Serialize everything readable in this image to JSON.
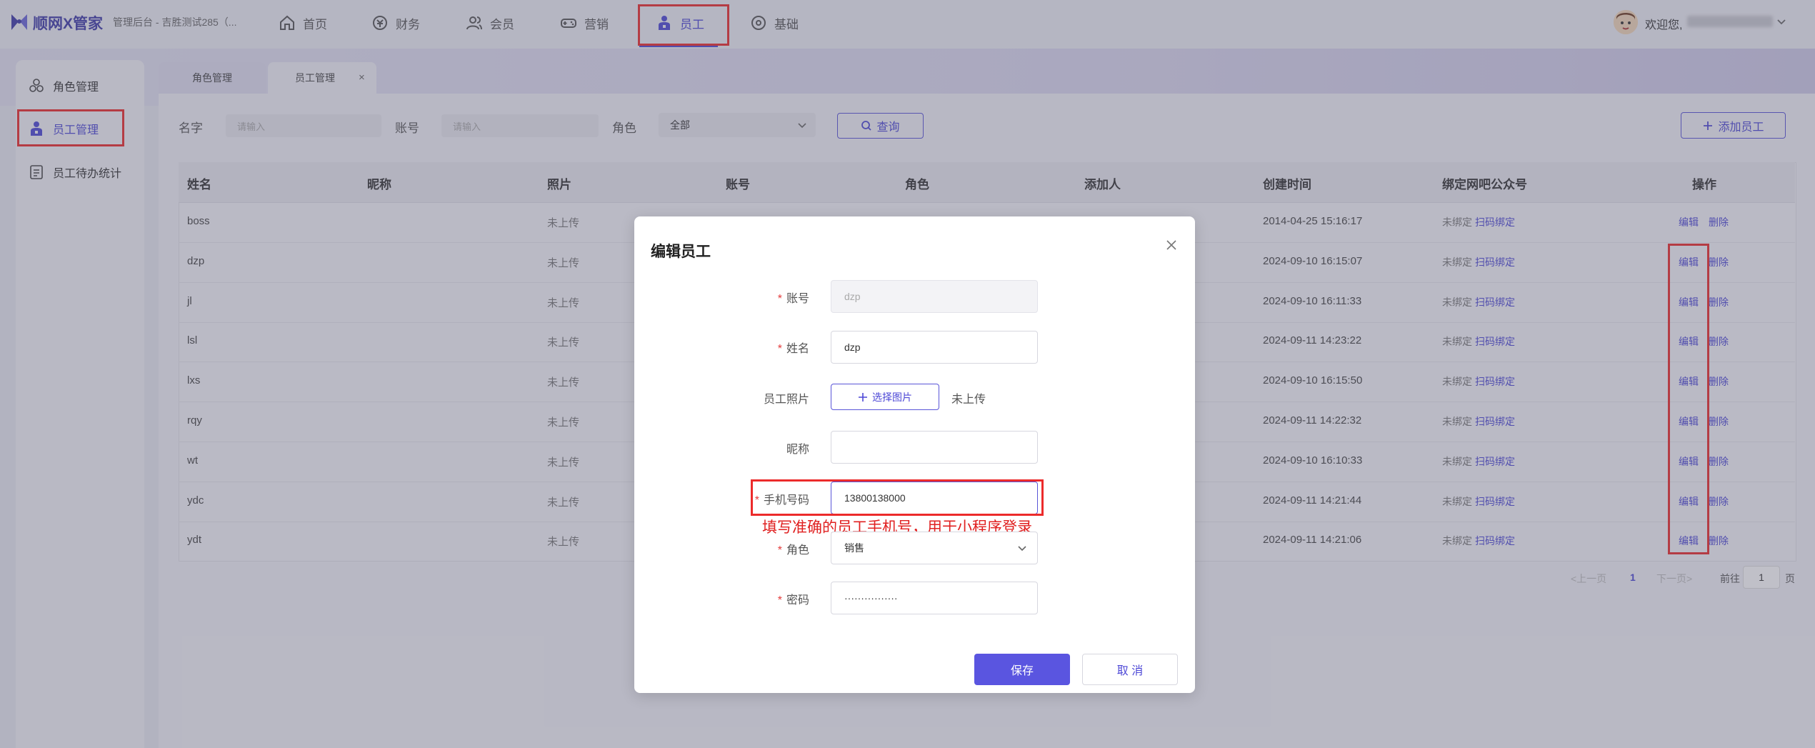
{
  "header": {
    "logo": "顺网X管家",
    "subtitle": "管理后台 - 吉胜测试285（...",
    "nav": [
      {
        "label": "首页",
        "icon": "home-icon"
      },
      {
        "label": "财务",
        "icon": "finance-icon"
      },
      {
        "label": "会员",
        "icon": "member-icon"
      },
      {
        "label": "营销",
        "icon": "gamepad-icon"
      },
      {
        "label": "员工",
        "icon": "staff-icon",
        "active": true
      },
      {
        "label": "基础",
        "icon": "settings-icon"
      }
    ],
    "welcome": "欢迎您,"
  },
  "sidebar": {
    "items": [
      {
        "label": "角色管理",
        "icon": "role-icon"
      },
      {
        "label": "员工管理",
        "icon": "staff-icon",
        "active": true
      },
      {
        "label": "员工待办统计",
        "icon": "stats-icon"
      }
    ]
  },
  "tabs": [
    {
      "label": "角色管理"
    },
    {
      "label": "员工管理",
      "closable": true
    }
  ],
  "filters": {
    "name_label": "名字",
    "name_placeholder": "请输入",
    "account_label": "账号",
    "account_placeholder": "请输入",
    "role_label": "角色",
    "role_value": "全部",
    "search_button": "查询",
    "add_button": "添加员工"
  },
  "table": {
    "columns": [
      "姓名",
      "昵称",
      "照片",
      "账号",
      "角色",
      "添加人",
      "创建时间",
      "绑定网吧公众号",
      "操作"
    ],
    "rows": [
      {
        "name": "boss",
        "photo": "未上传",
        "created": "2014-04-25 15:16:17",
        "bind_status": "未绑定",
        "bind_link": "扫码绑定",
        "edit": "编辑",
        "delete": "删除"
      },
      {
        "name": "dzp",
        "photo": "未上传",
        "created": "2024-09-10 16:15:07",
        "bind_status": "未绑定",
        "bind_link": "扫码绑定",
        "edit": "编辑",
        "delete": "删除"
      },
      {
        "name": "jl",
        "photo": "未上传",
        "created": "2024-09-10 16:11:33",
        "bind_status": "未绑定",
        "bind_link": "扫码绑定",
        "edit": "编辑",
        "delete": "删除"
      },
      {
        "name": "lsl",
        "photo": "未上传",
        "created": "2024-09-11 14:23:22",
        "bind_status": "未绑定",
        "bind_link": "扫码绑定",
        "edit": "编辑",
        "delete": "删除"
      },
      {
        "name": "lxs",
        "photo": "未上传",
        "created": "2024-09-10 16:15:50",
        "bind_status": "未绑定",
        "bind_link": "扫码绑定",
        "edit": "编辑",
        "delete": "删除"
      },
      {
        "name": "rqy",
        "photo": "未上传",
        "created": "2024-09-11 14:22:32",
        "bind_status": "未绑定",
        "bind_link": "扫码绑定",
        "edit": "编辑",
        "delete": "删除"
      },
      {
        "name": "wt",
        "photo": "未上传",
        "created": "2024-09-10 16:10:33",
        "bind_status": "未绑定",
        "bind_link": "扫码绑定",
        "edit": "编辑",
        "delete": "删除"
      },
      {
        "name": "ydc",
        "photo": "未上传",
        "created": "2024-09-11 14:21:44",
        "bind_status": "未绑定",
        "bind_link": "扫码绑定",
        "edit": "编辑",
        "delete": "删除"
      },
      {
        "name": "ydt",
        "photo": "未上传",
        "created": "2024-09-11 14:21:06",
        "bind_status": "未绑定",
        "bind_link": "扫码绑定",
        "edit": "编辑",
        "delete": "删除"
      }
    ]
  },
  "pagination": {
    "prev": "<上一页",
    "current": "1",
    "next": "下一页>",
    "goto_label": "前往",
    "goto_value": "1",
    "page_suffix": "页"
  },
  "modal": {
    "title": "编辑员工",
    "fields": {
      "account_label": "账号",
      "account_value": "dzp",
      "name_label": "姓名",
      "name_value": "dzp",
      "photo_label": "员工照片",
      "photo_button": "选择图片",
      "photo_status": "未上传",
      "nickname_label": "昵称",
      "nickname_value": "",
      "phone_label": "手机号码",
      "phone_value": "13800138000",
      "phone_hint": "填写准确的员工手机号，用于小程序登录",
      "role_label": "角色",
      "role_value": "销售",
      "password_label": "密码",
      "password_value": "················"
    },
    "save_button": "保存",
    "cancel_button": "取 消"
  },
  "colors": {
    "accent": "#4c47d6",
    "primary_button": "#5a55e0",
    "highlight_box": "#ec2b2b",
    "hint_text": "#e02020"
  }
}
